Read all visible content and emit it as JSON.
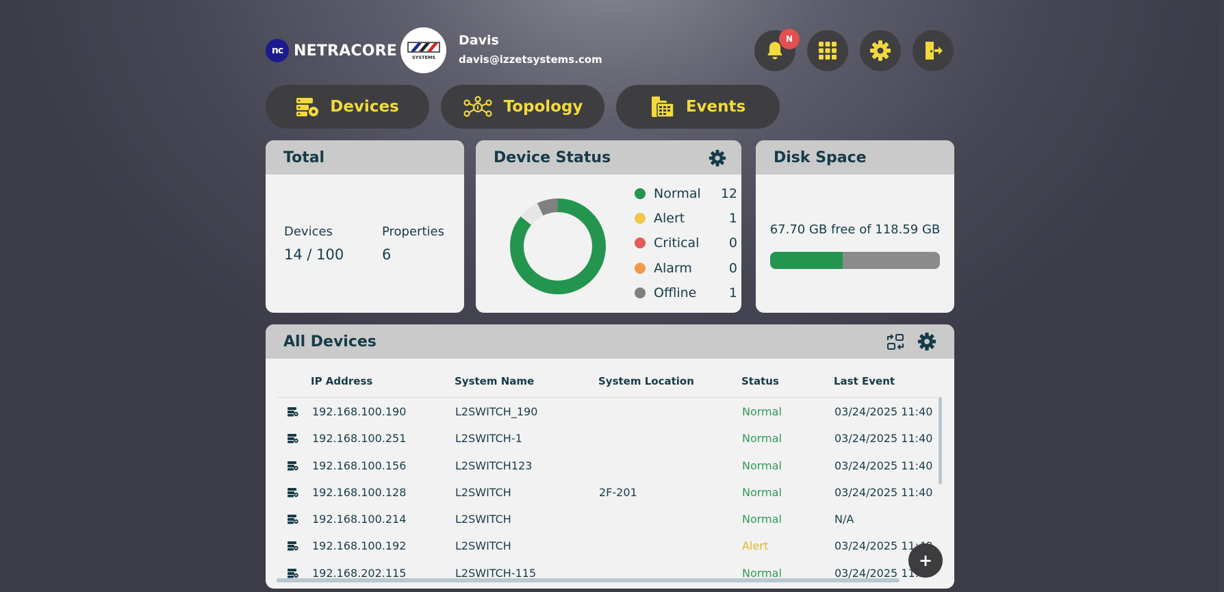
{
  "brand": {
    "mark": "nc",
    "name": "NETRACORE"
  },
  "user": {
    "name": "Davis",
    "email": "davis@izzetsystems.com",
    "avatar_logo_text": "SYSTEMS"
  },
  "header_buttons": [
    {
      "icon": "bell-icon",
      "badge": "N"
    },
    {
      "icon": "apps-grid-icon"
    },
    {
      "icon": "gear-icon"
    },
    {
      "icon": "logout-icon"
    }
  ],
  "nav": {
    "tabs": [
      {
        "label": "Devices",
        "icon": "server-gear-icon"
      },
      {
        "label": "Topology",
        "icon": "network-topology-icon"
      },
      {
        "label": "Events",
        "icon": "calendar-list-icon"
      }
    ]
  },
  "total_card": {
    "title": "Total",
    "devices_label": "Devices",
    "devices_value": "14 / 100",
    "properties_label": "Properties",
    "properties_value": "6"
  },
  "status_card": {
    "title": "Device Status",
    "legend": [
      {
        "label": "Normal",
        "count": "12",
        "color": "#23954f"
      },
      {
        "label": "Alert",
        "count": "1",
        "color": "#f0c84a"
      },
      {
        "label": "Critical",
        "count": "0",
        "color": "#e45b5b"
      },
      {
        "label": "Alarm",
        "count": "0",
        "color": "#f0994a"
      },
      {
        "label": "Offline",
        "count": "1",
        "color": "#808080"
      }
    ]
  },
  "disk_card": {
    "title": "Disk Space",
    "text": "67.70 GB free of 118.59 GB",
    "used_fraction": 0.429
  },
  "devices_table": {
    "title": "All Devices",
    "columns": [
      "IP Address",
      "System Name",
      "System Location",
      "Status",
      "Last Event"
    ],
    "rows": [
      {
        "ip": "192.168.100.190",
        "name": "L2SWITCH_190",
        "location": "",
        "status": "Normal",
        "last_event": "03/24/2025 11:40"
      },
      {
        "ip": "192.168.100.251",
        "name": "L2SWITCH-1",
        "location": "",
        "status": "Normal",
        "last_event": "03/24/2025 11:40"
      },
      {
        "ip": "192.168.100.156",
        "name": "L2SWITCH123",
        "location": "",
        "status": "Normal",
        "last_event": "03/24/2025 11:40"
      },
      {
        "ip": "192.168.100.128",
        "name": "L2SWITCH",
        "location": "2F-201",
        "status": "Normal",
        "last_event": "03/24/2025 11:40"
      },
      {
        "ip": "192.168.100.214",
        "name": "L2SWITCH",
        "location": "",
        "status": "Normal",
        "last_event": "N/A"
      },
      {
        "ip": "192.168.100.192",
        "name": "L2SWITCH",
        "location": "",
        "status": "Alert",
        "last_event": "03/24/2025 11:40"
      },
      {
        "ip": "192.168.202.115",
        "name": "L2SWITCH-115",
        "location": "",
        "status": "Normal",
        "last_event": "03/24/2025 11:40"
      }
    ],
    "fab_label": "+"
  },
  "colors": {
    "accent": "#f2da3c",
    "card_header": "#cacaca",
    "text": "#163b49",
    "normal": "#23954f",
    "alert": "#f0c84a"
  }
}
